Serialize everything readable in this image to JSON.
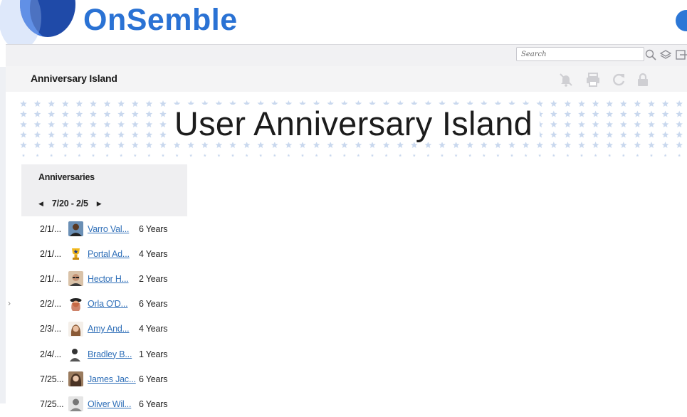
{
  "brand": {
    "name": "OnSemble"
  },
  "toolbar": {
    "search_placeholder": "Search",
    "icons": [
      "search-icon",
      "layers-icon",
      "exit-icon"
    ]
  },
  "header": {
    "title": "Anniversary Island",
    "icons": [
      "notifications-off-icon",
      "print-icon",
      "refresh-icon",
      "lock-icon"
    ]
  },
  "banner": {
    "title": "User Anniversary Island"
  },
  "widget": {
    "title": "Anniversaries",
    "range": "7/20 - 2/5",
    "items": [
      {
        "date": "2/1/...",
        "name": "Varro Val...",
        "years": "6 Years",
        "avatar": "person-dark"
      },
      {
        "date": "2/1/...",
        "name": "Portal Ad...",
        "years": "4 Years",
        "avatar": "trophy"
      },
      {
        "date": "2/1/...",
        "name": "Hector H...",
        "years": "2 Years",
        "avatar": "person-glasses"
      },
      {
        "date": "2/2/...",
        "name": "Orla O'D...",
        "years": "6 Years",
        "avatar": "person-hat"
      },
      {
        "date": "2/3/...",
        "name": "Amy And...",
        "years": "4 Years",
        "avatar": "person-woman"
      },
      {
        "date": "2/4/...",
        "name": "Bradley B...",
        "years": "1 Years",
        "avatar": "person-bw"
      },
      {
        "date": "7/25...",
        "name": "James Jac...",
        "years": "6 Years",
        "avatar": "person-woman2"
      },
      {
        "date": "7/25...",
        "name": "Oliver Wil...",
        "years": "6 Years",
        "avatar": "person-gray"
      }
    ]
  },
  "colors": {
    "brand": "#2a72d4",
    "link": "#2f6fb8",
    "panel": "#efeff1",
    "star": "#c9d8ee"
  }
}
